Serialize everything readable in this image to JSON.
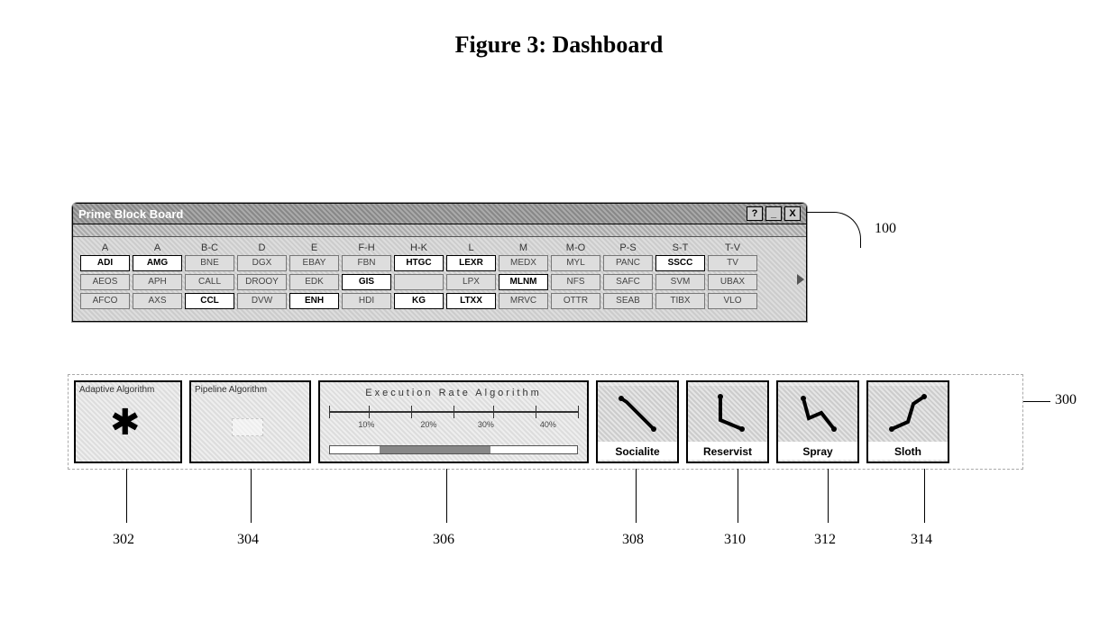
{
  "figure_title": "Figure 3: Dashboard",
  "window_title": "Prime Block Board",
  "titlebar_buttons": {
    "help": "?",
    "min": "_",
    "close": "X"
  },
  "column_headers": [
    "A",
    "A",
    "B-C",
    "D",
    "E",
    "F-H",
    "H-K",
    "L",
    "M",
    "M-O",
    "P-S",
    "S-T",
    "T-V"
  ],
  "rows": [
    [
      {
        "t": "ADI",
        "hl": true
      },
      {
        "t": "AMG",
        "hl": true
      },
      {
        "t": "BNE",
        "hl": false
      },
      {
        "t": "DGX",
        "hl": false
      },
      {
        "t": "EBAY",
        "hl": false
      },
      {
        "t": "FBN",
        "hl": false
      },
      {
        "t": "HTGC",
        "hl": true
      },
      {
        "t": "LEXR",
        "hl": true
      },
      {
        "t": "MEDX",
        "hl": false
      },
      {
        "t": "MYL",
        "hl": false
      },
      {
        "t": "PANC",
        "hl": false
      },
      {
        "t": "SSCC",
        "hl": true
      },
      {
        "t": "TV",
        "hl": false
      }
    ],
    [
      {
        "t": "AEOS",
        "hl": false
      },
      {
        "t": "APH",
        "hl": false
      },
      {
        "t": "CALL",
        "hl": false
      },
      {
        "t": "DROOY",
        "hl": false
      },
      {
        "t": "EDK",
        "hl": false
      },
      {
        "t": "GIS",
        "hl": true
      },
      {
        "t": "",
        "hl": false
      },
      {
        "t": "LPX",
        "hl": false
      },
      {
        "t": "MLNM",
        "hl": true
      },
      {
        "t": "NFS",
        "hl": false
      },
      {
        "t": "SAFC",
        "hl": false
      },
      {
        "t": "SVM",
        "hl": false
      },
      {
        "t": "UBAX",
        "hl": false
      }
    ],
    [
      {
        "t": "AFCO",
        "hl": false
      },
      {
        "t": "AXS",
        "hl": false
      },
      {
        "t": "CCL",
        "hl": true
      },
      {
        "t": "DVW",
        "hl": false
      },
      {
        "t": "ENH",
        "hl": true
      },
      {
        "t": "HDI",
        "hl": false
      },
      {
        "t": "KG",
        "hl": true
      },
      {
        "t": "LTXX",
        "hl": true
      },
      {
        "t": "MRVC",
        "hl": false
      },
      {
        "t": "OTTR",
        "hl": false
      },
      {
        "t": "SEAB",
        "hl": false
      },
      {
        "t": "TIBX",
        "hl": false
      },
      {
        "t": "VLO",
        "hl": false
      }
    ]
  ],
  "panels": {
    "adaptive": "Adaptive Algorithm",
    "pipeline": "Pipeline  Algorithm",
    "exec_title": "Execution     Rate     Algorithm",
    "exec_labels": [
      "10%",
      "20%",
      "30%",
      "40%"
    ]
  },
  "strategies": [
    {
      "name": "Socialite"
    },
    {
      "name": "Reservist"
    },
    {
      "name": "Spray"
    },
    {
      "name": "Sloth"
    }
  ],
  "callouts": {
    "c100": "100",
    "c300": "300",
    "c302": "302",
    "c304": "304",
    "c306": "306",
    "c308": "308",
    "c310": "310",
    "c312": "312",
    "c314": "314"
  }
}
